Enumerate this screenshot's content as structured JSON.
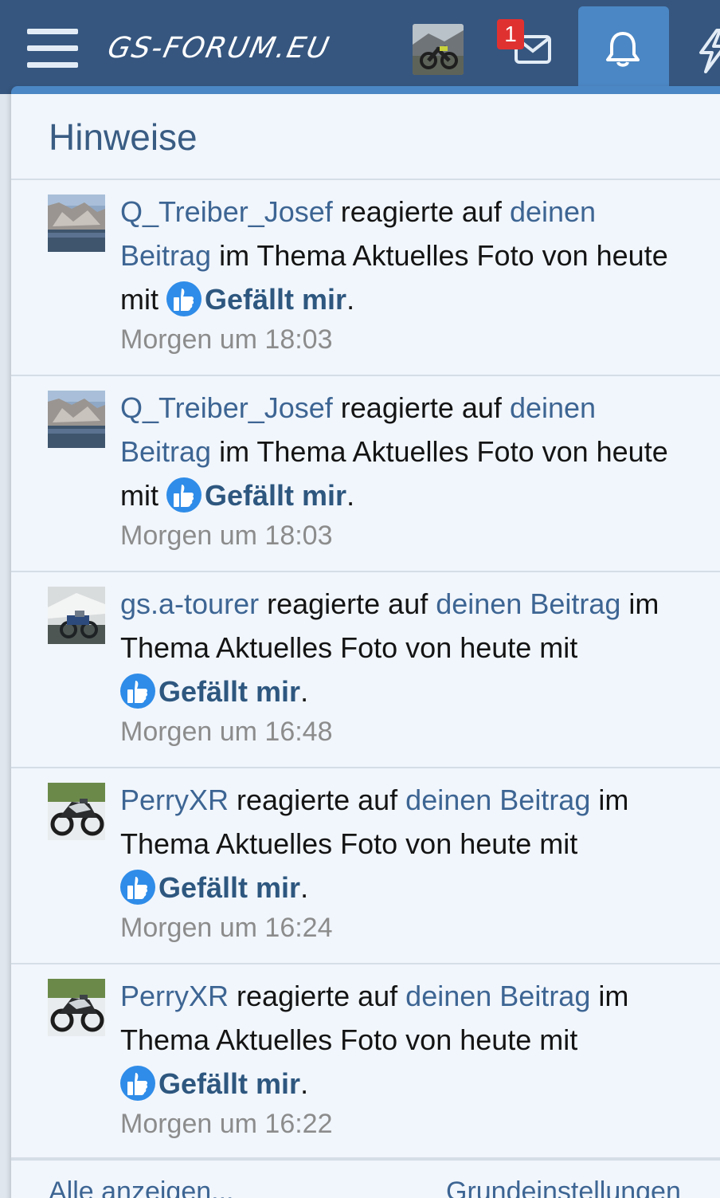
{
  "header": {
    "logo_text": "GS-FORUM.EU",
    "inbox_badge": "1",
    "brand_color": "#36567f",
    "accent_color": "#4b87c4"
  },
  "panel": {
    "title": "Hinweise"
  },
  "alerts": [
    {
      "user": "Q_Treiber_Josef",
      "action": " reagierte auf ",
      "link": "deinen Beitrag",
      "middle": " im Thema Aktuelles Foto von heute mit ",
      "reaction": "Gefällt mir",
      "end": ".",
      "time": "Morgen um 18:03",
      "avatar": "lake-cliff"
    },
    {
      "user": "Q_Treiber_Josef",
      "action": " reagierte auf ",
      "link": "deinen Beitrag",
      "middle": " im Thema Aktuelles Foto von heute mit ",
      "reaction": "Gefällt mir",
      "end": ".",
      "time": "Morgen um 18:03",
      "avatar": "lake-cliff"
    },
    {
      "user": "gs.a-tourer",
      "action": " reagierte auf ",
      "link": "deinen Beitrag",
      "middle": " im Thema Aktuelles Foto von heute mit ",
      "reaction": "Gefällt mir",
      "end": ".",
      "time": "Morgen um 16:48",
      "avatar": "motorbike-tent"
    },
    {
      "user": "PerryXR",
      "action": " reagierte auf ",
      "link": "deinen Beitrag",
      "middle": " im Thema Aktuelles Foto von heute mit ",
      "reaction": "Gefällt mir",
      "end": ".",
      "time": "Morgen um 16:24",
      "avatar": "motorbike"
    },
    {
      "user": "PerryXR",
      "action": " reagierte auf ",
      "link": "deinen Beitrag",
      "middle": " im Thema Aktuelles Foto von heute mit ",
      "reaction": "Gefällt mir",
      "end": ".",
      "time": "Morgen um 16:22",
      "avatar": "motorbike"
    }
  ],
  "footer": {
    "show_all": "Alle anzeigen...",
    "preferences": "Grundeinstellungen"
  }
}
